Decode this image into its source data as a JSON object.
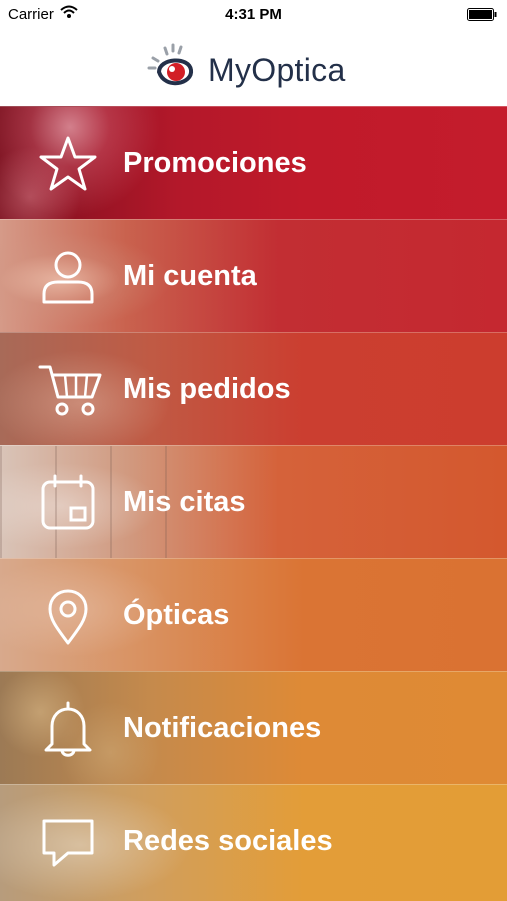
{
  "status_bar": {
    "carrier": "Carrier",
    "time": "4:31 PM"
  },
  "header": {
    "brand": "MyOptica",
    "logo_icon": "myoptica-logo-icon"
  },
  "menu": {
    "items": [
      {
        "label": "Promociones",
        "icon": "star-icon",
        "color": "#c01a2a"
      },
      {
        "label": "Mi cuenta",
        "icon": "user-icon",
        "color": "#c52830"
      },
      {
        "label": "Mis pedidos",
        "icon": "cart-icon",
        "color": "#cc3d2e"
      },
      {
        "label": "Mis citas",
        "icon": "calendar-icon",
        "color": "#d4582e"
      },
      {
        "label": "Ópticas",
        "icon": "location-pin-icon",
        "color": "#da7232"
      },
      {
        "label": "Notificaciones",
        "icon": "bell-icon",
        "color": "#df8a34"
      },
      {
        "label": "Redes sociales",
        "icon": "chat-bubble-icon",
        "color": "#e39d36"
      }
    ]
  }
}
